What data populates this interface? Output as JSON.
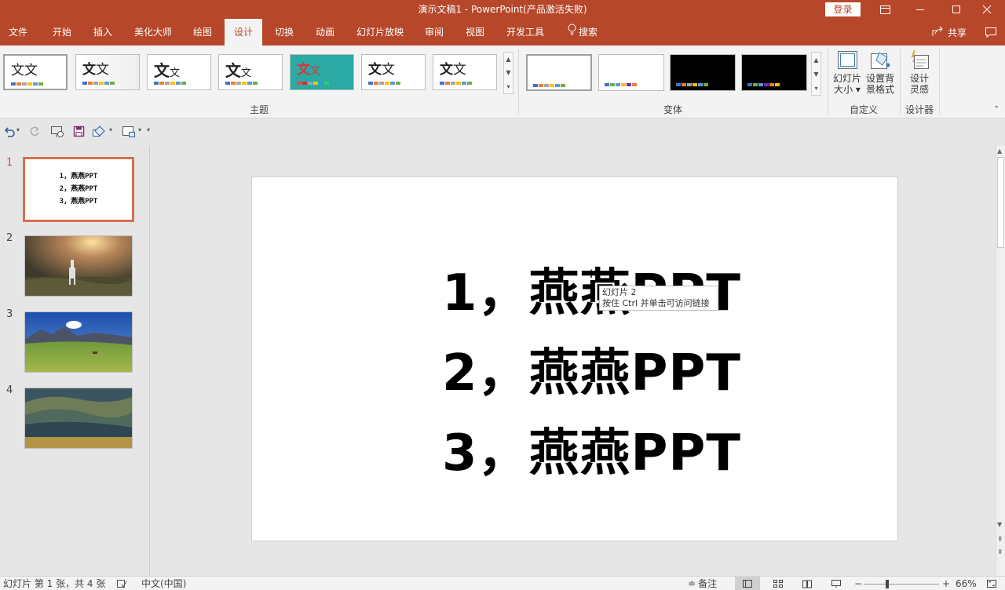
{
  "window": {
    "title": "演示文稿1  -  PowerPoint(产品激活失败)",
    "login_label": "登录",
    "share_label": "共享"
  },
  "tabs": [
    {
      "label": "文件"
    },
    {
      "label": "开始"
    },
    {
      "label": "插入"
    },
    {
      "label": "美化大师"
    },
    {
      "label": "绘图"
    },
    {
      "label": "设计",
      "active": true
    },
    {
      "label": "切换"
    },
    {
      "label": "动画"
    },
    {
      "label": "幻灯片放映"
    },
    {
      "label": "审阅"
    },
    {
      "label": "视图"
    },
    {
      "label": "开发工具"
    },
    {
      "label": "搜索"
    }
  ],
  "ribbon": {
    "themes_group_label": "主题",
    "variants_group_label": "变体",
    "customize_group_label": "自定义",
    "designer_group_label": "设计器",
    "theme_text": "文",
    "slide_size_label": "幻灯片\n大小",
    "slide_size_line1": "幻灯片",
    "slide_size_line2": "大小",
    "format_bg_line1": "设置背",
    "format_bg_line2": "景格式",
    "design_ideas_line1": "设计",
    "design_ideas_line2": "灵感"
  },
  "colors": {
    "accent": "#b7472a",
    "selected_slide_border": "#d9704f",
    "palette": [
      "#4472c4",
      "#ed7d31",
      "#a5a5a5",
      "#ffc000",
      "#5b9bd5",
      "#70ad47"
    ]
  },
  "slides_panel": {
    "slides": [
      {
        "number": "1",
        "lines": [
          "1，燕燕PPT",
          "2，燕燕PPT",
          "3，燕燕PPT"
        ],
        "selected": true
      },
      {
        "number": "2",
        "image": "horse-at-sunset-photo"
      },
      {
        "number": "3",
        "image": "mountain-grassland-photo"
      },
      {
        "number": "4",
        "image": "rolling-hills-photo"
      }
    ]
  },
  "slide": {
    "lines": [
      "1，燕燕PPT",
      "2，燕燕PPT",
      "3，燕燕PPT"
    ]
  },
  "tooltip": {
    "line1": "幻灯片 2",
    "line2": "按住 Ctrl 并单击可访问链接"
  },
  "statusbar": {
    "slide_info": "幻灯片 第 1 张，共 4 张",
    "language": "中文(中国)",
    "notes_label": "备注",
    "zoom": "66%"
  }
}
